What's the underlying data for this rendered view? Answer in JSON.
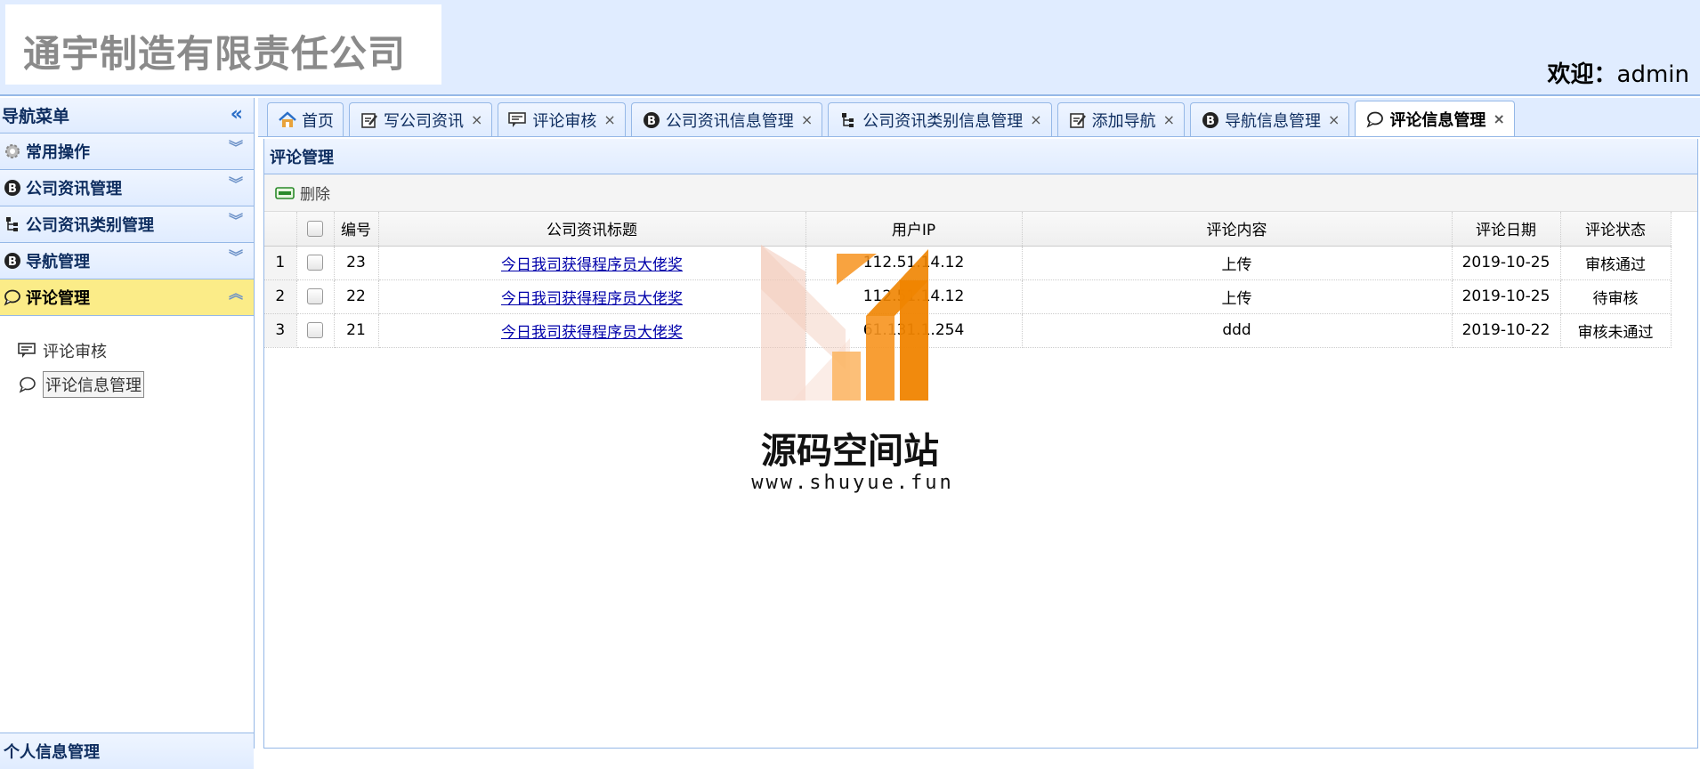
{
  "header": {
    "company": "通宇制造有限责任公司",
    "welcome_label": "欢迎：",
    "username": "admin"
  },
  "sidebar": {
    "title": "导航菜单",
    "panels": [
      {
        "label": "常用操作",
        "icon": "gear-icon"
      },
      {
        "label": "公司资讯管理",
        "icon": "blogger-icon"
      },
      {
        "label": "公司资讯类别管理",
        "icon": "tree-icon"
      },
      {
        "label": "导航管理",
        "icon": "blogger-icon"
      },
      {
        "label": "评论管理",
        "icon": "comment-icon"
      }
    ],
    "items": [
      {
        "label": "评论审核",
        "icon": "review-icon"
      },
      {
        "label": "评论信息管理",
        "icon": "comment-icon"
      }
    ],
    "bottom_panel": "个人信息管理"
  },
  "tabs": [
    {
      "label": "首页",
      "icon": "home-icon",
      "closable": false
    },
    {
      "label": "写公司资讯",
      "icon": "edit-icon",
      "closable": true
    },
    {
      "label": "评论审核",
      "icon": "review-icon",
      "closable": true
    },
    {
      "label": "公司资讯信息管理",
      "icon": "blogger-icon",
      "closable": true
    },
    {
      "label": "公司资讯类别信息管理",
      "icon": "tree-icon",
      "closable": true
    },
    {
      "label": "添加导航",
      "icon": "edit-icon",
      "closable": true
    },
    {
      "label": "导航信息管理",
      "icon": "blogger-icon",
      "closable": true
    },
    {
      "label": "评论信息管理",
      "icon": "comment-icon",
      "closable": true,
      "active": true
    }
  ],
  "close_glyph": "×",
  "panel": {
    "title": "评论管理",
    "delete_label": "删除"
  },
  "grid": {
    "columns": [
      "编号",
      "公司资讯标题",
      "用户IP",
      "评论内容",
      "评论日期",
      "评论状态"
    ],
    "rows": [
      {
        "rn": "1",
        "id": "23",
        "title": "今日我司获得程序员大佬奖",
        "ip": "112.51.14.12",
        "content": "上传",
        "date": "2019-10-25",
        "status": "审核通过"
      },
      {
        "rn": "2",
        "id": "22",
        "title": "今日我司获得程序员大佬奖",
        "ip": "112.51.14.12",
        "content": "上传",
        "date": "2019-10-25",
        "status": "待审核"
      },
      {
        "rn": "3",
        "id": "21",
        "title": "今日我司获得程序员大佬奖",
        "ip": "61.131.1.254",
        "content": "ddd",
        "date": "2019-10-22",
        "status": "审核未通过"
      }
    ]
  },
  "watermark": {
    "title": "源码空间站",
    "url": "www.shuyue.fun"
  },
  "colors": {
    "header_bg": "#e0ecff",
    "border": "#95b8e7",
    "active_panel": "#fbec88",
    "link": "#0000aa",
    "watermark_orange": "#f7931e"
  }
}
